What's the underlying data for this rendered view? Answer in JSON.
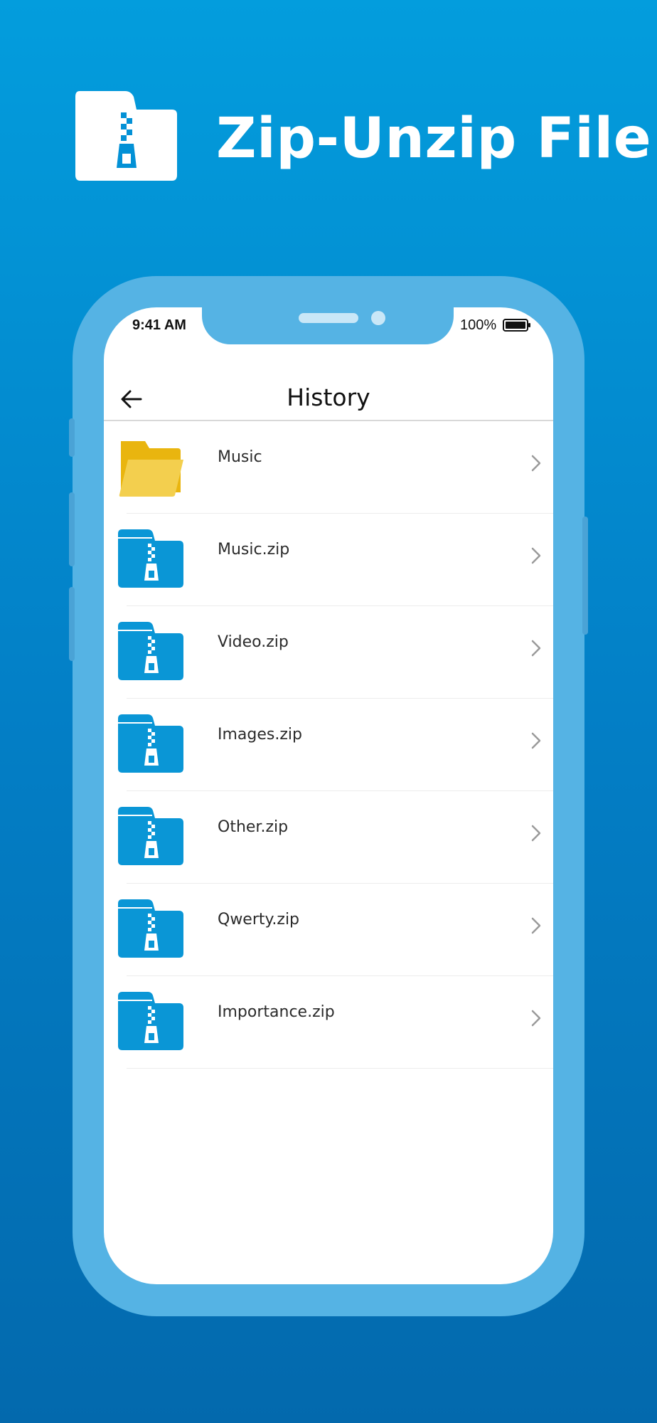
{
  "app": {
    "title": "Zip-Unzip File"
  },
  "status_bar": {
    "time": "9:41 AM",
    "battery": "100%"
  },
  "header": {
    "title": "History"
  },
  "items": [
    {
      "label": "Music",
      "type": "folder"
    },
    {
      "label": "Music.zip",
      "type": "zip"
    },
    {
      "label": "Video.zip",
      "type": "zip"
    },
    {
      "label": "Images.zip",
      "type": "zip"
    },
    {
      "label": "Other.zip",
      "type": "zip"
    },
    {
      "label": "Qwerty.zip",
      "type": "zip"
    },
    {
      "label": "Importance.zip",
      "type": "zip"
    }
  ],
  "colors": {
    "background_top": "#039ddd",
    "background_bottom": "#0369ad",
    "zip_icon": "#0a96d6",
    "folder_icon": "#f0c419",
    "phone_frame": "#55b3e4"
  }
}
